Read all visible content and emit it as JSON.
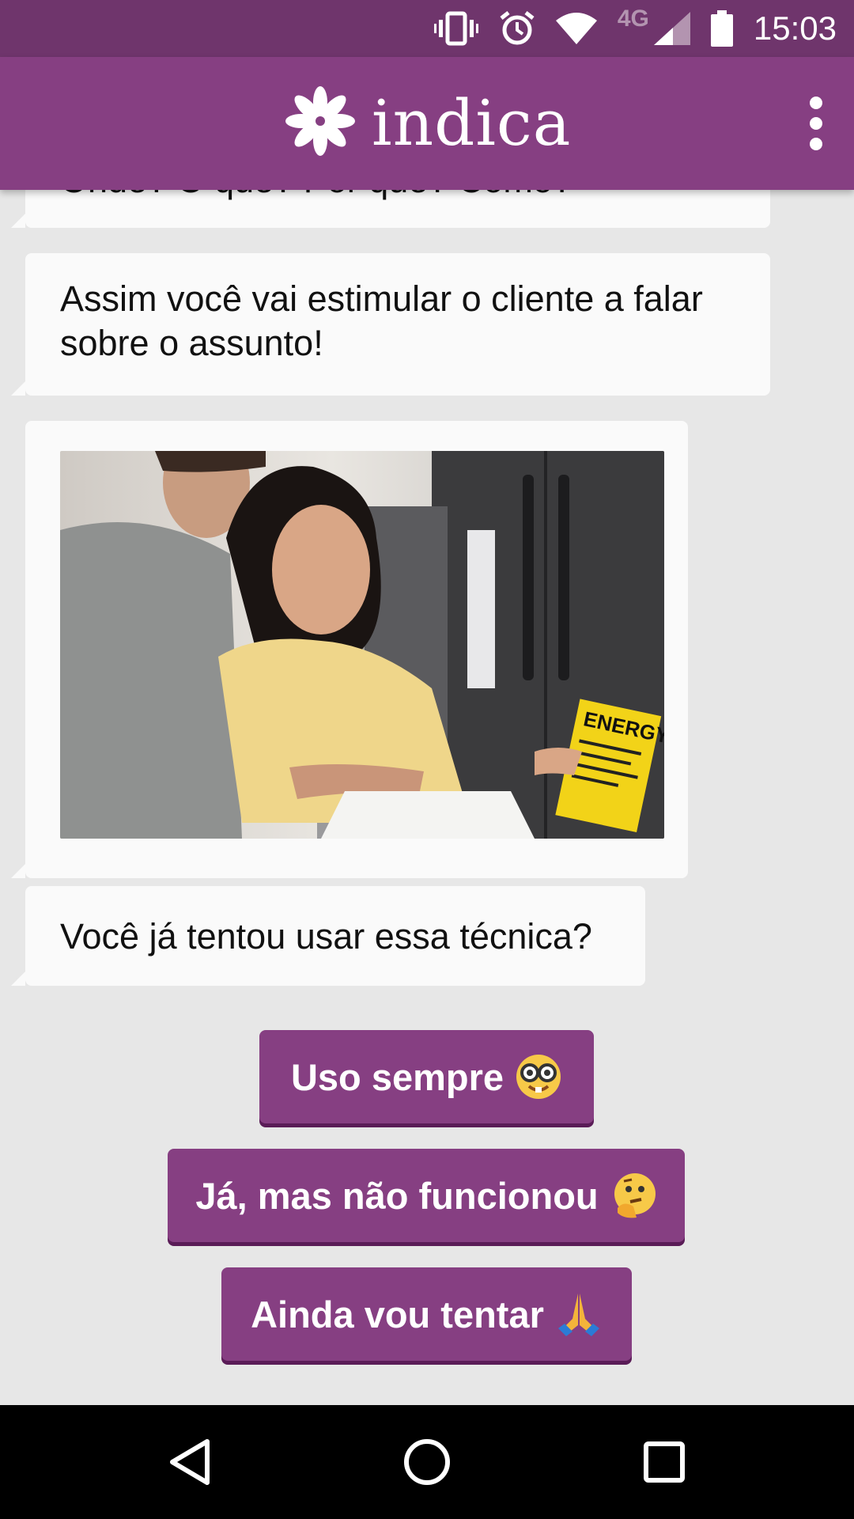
{
  "status_bar": {
    "time": "15:03",
    "network_label": "4G",
    "icons": [
      "vibrate-icon",
      "alarm-icon",
      "wifi-icon",
      "signal-icon",
      "battery-icon"
    ]
  },
  "app_bar": {
    "brand_name": "indica",
    "logo_icon": "asterisk-flower-logo",
    "menu_icon": "overflow-menu-icon"
  },
  "colors": {
    "primary": "#863f82",
    "status_bar": "#6f356c",
    "button_shadow": "#5a1c57",
    "background": "#e7e7e7",
    "bubble": "#fafafa"
  },
  "messages": [
    {
      "type": "text",
      "text": "Onde? O quê? Por quê? Como?"
    },
    {
      "type": "text",
      "text": "Assim você vai estimular o cliente a falar sobre o assunto!"
    },
    {
      "type": "image",
      "image_label": "ENERGY"
    },
    {
      "type": "text",
      "text": "Você já tentou usar essa técnica?"
    }
  ],
  "quick_replies": [
    {
      "label": "Uso sempre",
      "emoji": "nerd-face-emoji"
    },
    {
      "label": "Já, mas não funcionou",
      "emoji": "thinking-face-emoji"
    },
    {
      "label": "Ainda vou tentar",
      "emoji": "folded-hands-emoji"
    }
  ],
  "nav_bar": {
    "icons": [
      "back-icon",
      "home-icon",
      "recents-icon"
    ]
  }
}
